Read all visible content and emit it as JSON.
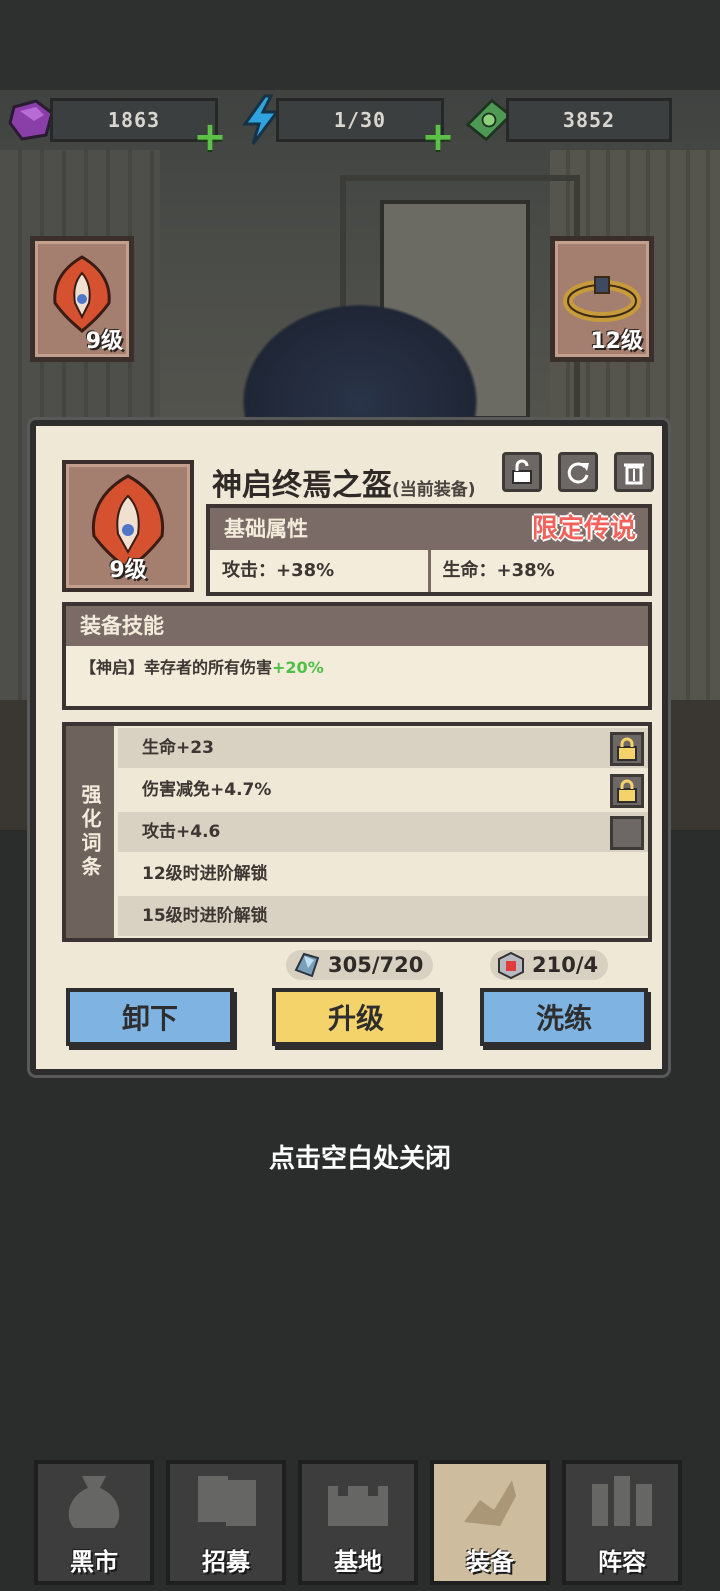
{
  "resources": {
    "gems": "1863",
    "energy": "1/30",
    "cash": "3852"
  },
  "side_slots": {
    "left_level": "9级",
    "right_level": "12级"
  },
  "item": {
    "name": "神启终焉之盔",
    "status": "(当前装备)",
    "level": "9级",
    "icons": [
      "unlock-icon",
      "refresh-icon",
      "trash-icon"
    ]
  },
  "base_attributes": {
    "header": "基础属性",
    "rarity": "限定传说",
    "attack": "攻击：+38%",
    "life": "生命：+38%"
  },
  "skill": {
    "header": "装备技能",
    "text": "【神启】幸存者的所有伤害",
    "bonus": "+20%"
  },
  "affixes": {
    "header": "强化词条",
    "rows": [
      {
        "text": "生命+23",
        "lock": "locked"
      },
      {
        "text": "伤害减免+4.7%",
        "lock": "locked"
      },
      {
        "text": "攻击+4.6",
        "lock": "unlocked"
      },
      {
        "text": "12级时进阶解锁",
        "lock": "none"
      },
      {
        "text": "15级时进阶解锁",
        "lock": "none"
      }
    ]
  },
  "costs": {
    "crystal": "305/720",
    "cube": "210/4"
  },
  "buttons": {
    "unequip": "卸下",
    "upgrade": "升级",
    "reroll": "洗练"
  },
  "close_hint": "点击空白处关闭",
  "nav": [
    {
      "label": "黑市"
    },
    {
      "label": "招募"
    },
    {
      "label": "基地"
    },
    {
      "label": "装备",
      "active": true
    },
    {
      "label": "阵容"
    }
  ],
  "colors": {
    "rarity": "#f2625a",
    "bonus": "#4fbf45",
    "button_blue": "#7fb4e2",
    "button_yellow": "#f4d36a"
  }
}
